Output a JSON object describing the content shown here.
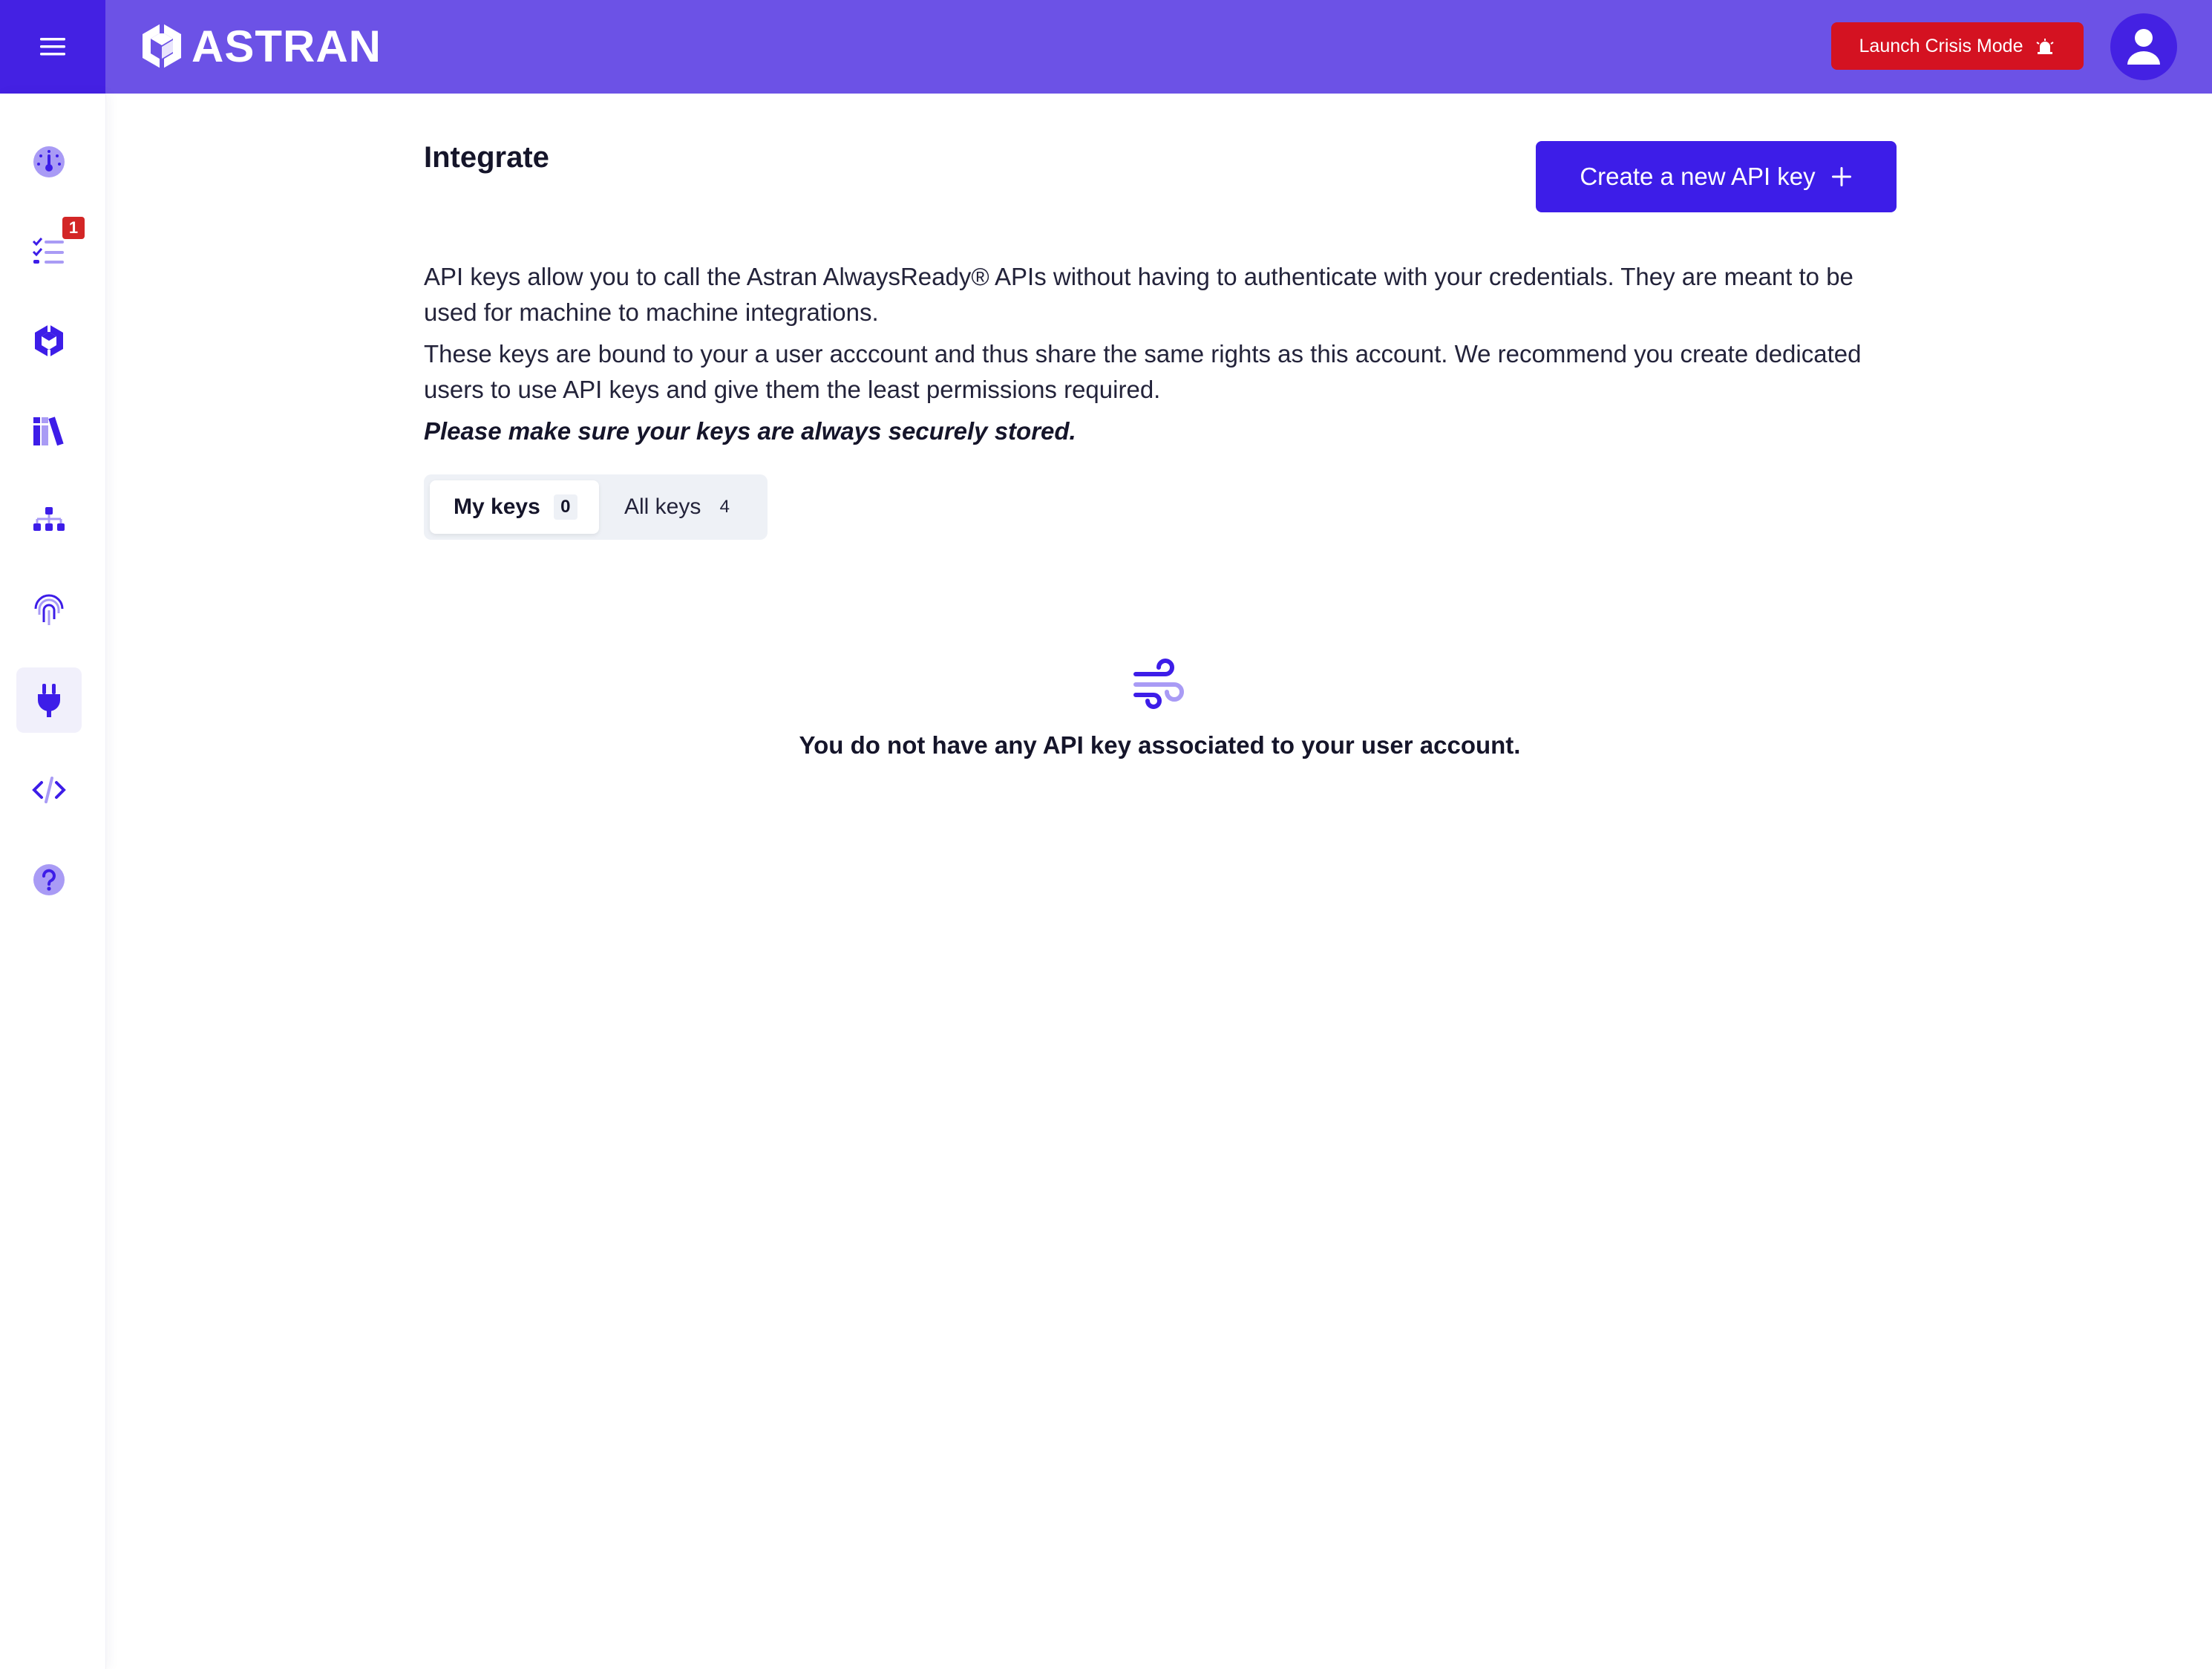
{
  "header": {
    "brand": "ASTRAN",
    "crisis_button_label": "Launch Crisis Mode"
  },
  "sidebar": {
    "items": [
      {
        "icon": "dashboard-gauge-icon"
      },
      {
        "icon": "tasks-list-icon",
        "badge": "1"
      },
      {
        "icon": "astran-cube-icon"
      },
      {
        "icon": "library-books-icon"
      },
      {
        "icon": "org-hierarchy-icon"
      },
      {
        "icon": "fingerprint-icon"
      },
      {
        "icon": "plug-icon",
        "active": true
      },
      {
        "icon": "code-icon"
      },
      {
        "icon": "help-icon"
      }
    ]
  },
  "main": {
    "title": "Integrate",
    "create_button_label": "Create a new API key",
    "paragraphs": [
      "API keys allow you to call the Astran AlwaysReady® APIs without having to authenticate with your credentials. They are meant to be used for machine to machine integrations.",
      "These keys are bound to your a user acccount and thus share the same rights as this account. We recommend you create dedicated users to use API keys and give them the least permissions required.",
      "Please make sure your keys are always securely stored."
    ],
    "tabs": [
      {
        "label": "My keys",
        "count": "0",
        "active": true
      },
      {
        "label": "All keys",
        "count": "4",
        "active": false
      }
    ],
    "empty_state": {
      "icon": "wind-icon",
      "message": "You do not have any API key associated to your user account."
    }
  },
  "colors": {
    "topbar": "#6c52e6",
    "primary": "#3d1de8",
    "crisis": "#d41221",
    "badge": "#d32626",
    "icon_light": "#a99bf5"
  }
}
